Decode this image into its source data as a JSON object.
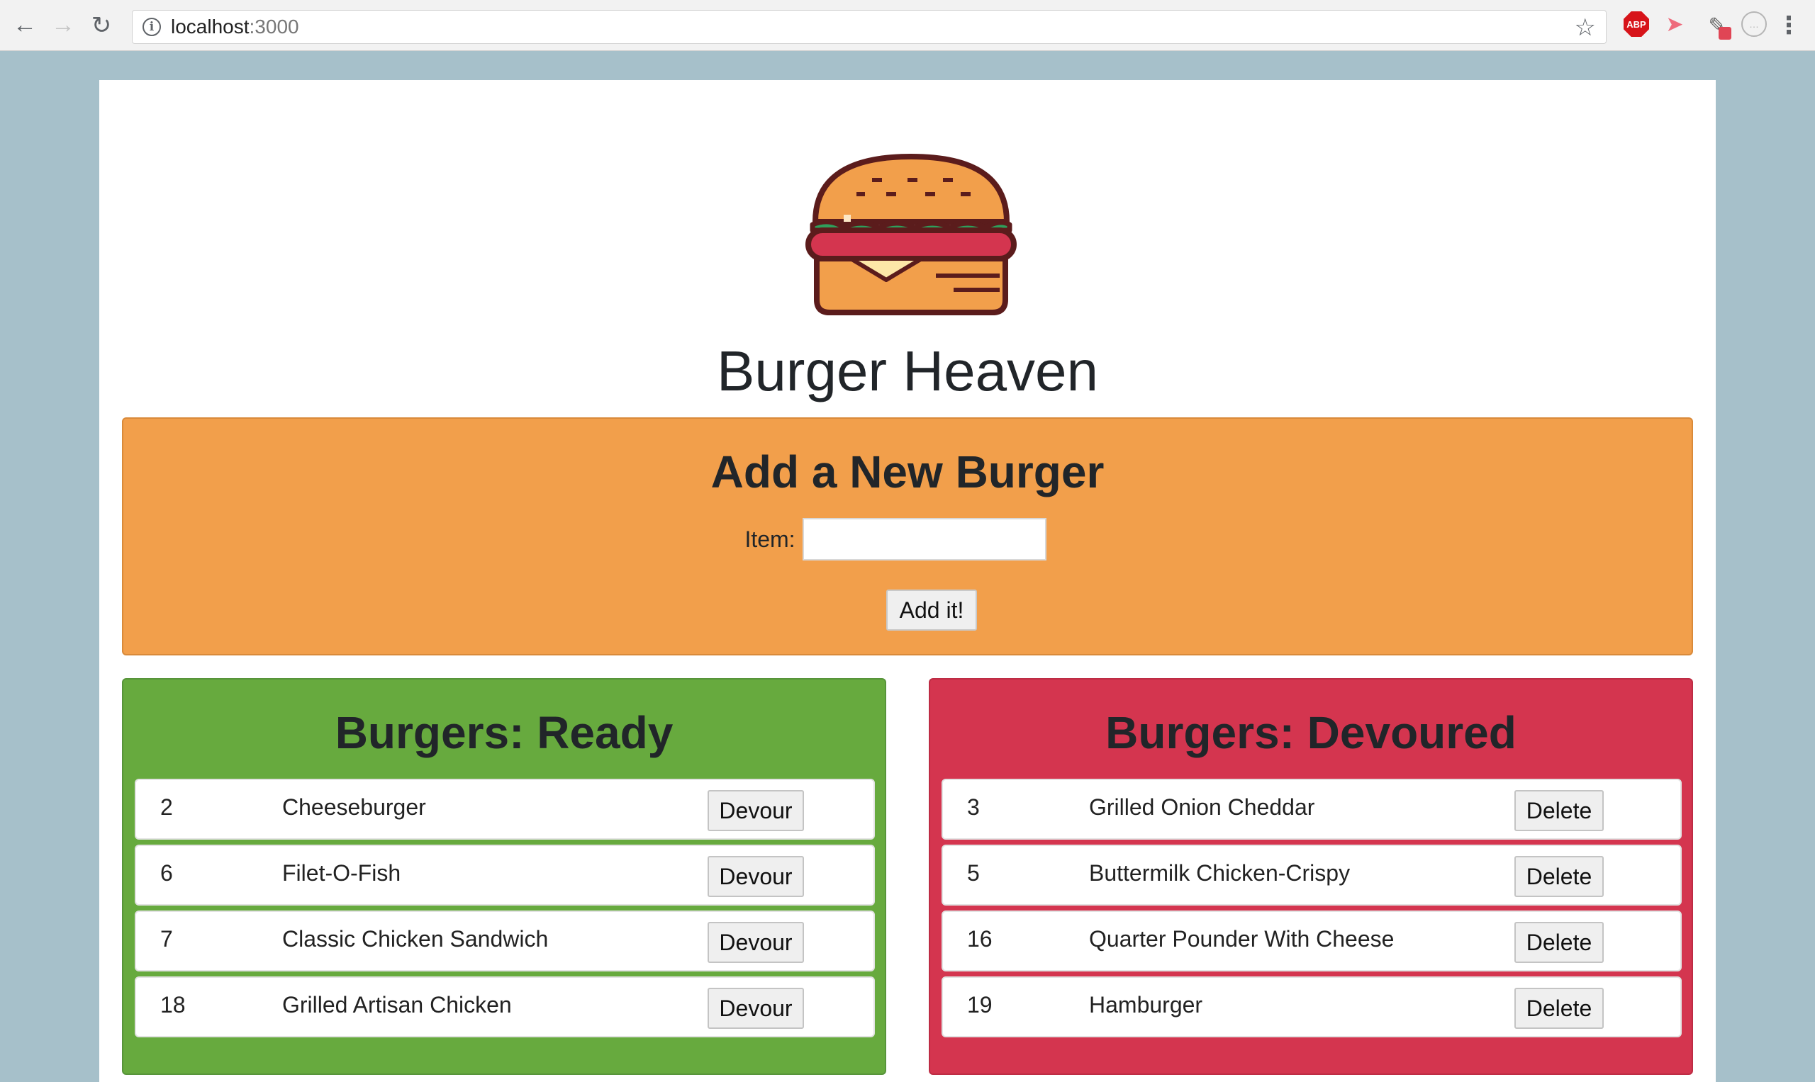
{
  "browser": {
    "url_host": "localhost",
    "url_port": ":3000",
    "abp_label": "ABP"
  },
  "header": {
    "title": "Burger Heaven",
    "logo_icon": "burger-icon"
  },
  "add_form": {
    "title": "Add a New Burger",
    "item_label": "Item:",
    "item_value": "",
    "submit_label": "Add it!"
  },
  "ready": {
    "title": "Burgers: Ready",
    "action_label": "Devour",
    "items": [
      {
        "id": "2",
        "name": "Cheeseburger"
      },
      {
        "id": "6",
        "name": "Filet-O-Fish"
      },
      {
        "id": "7",
        "name": "Classic Chicken Sandwich"
      },
      {
        "id": "18",
        "name": "Grilled Artisan Chicken"
      }
    ]
  },
  "devoured": {
    "title": "Burgers: Devoured",
    "action_label": "Delete",
    "items": [
      {
        "id": "3",
        "name": "Grilled Onion Cheddar"
      },
      {
        "id": "5",
        "name": "Buttermilk Chicken-Crispy"
      },
      {
        "id": "16",
        "name": "Quarter Pounder With Cheese"
      },
      {
        "id": "19",
        "name": "Hamburger"
      }
    ]
  },
  "colors": {
    "page_bg": "#a6c0ca",
    "add_card": "#f29f4b",
    "ready_card": "#67aa3e",
    "devoured_card": "#d4354f"
  }
}
